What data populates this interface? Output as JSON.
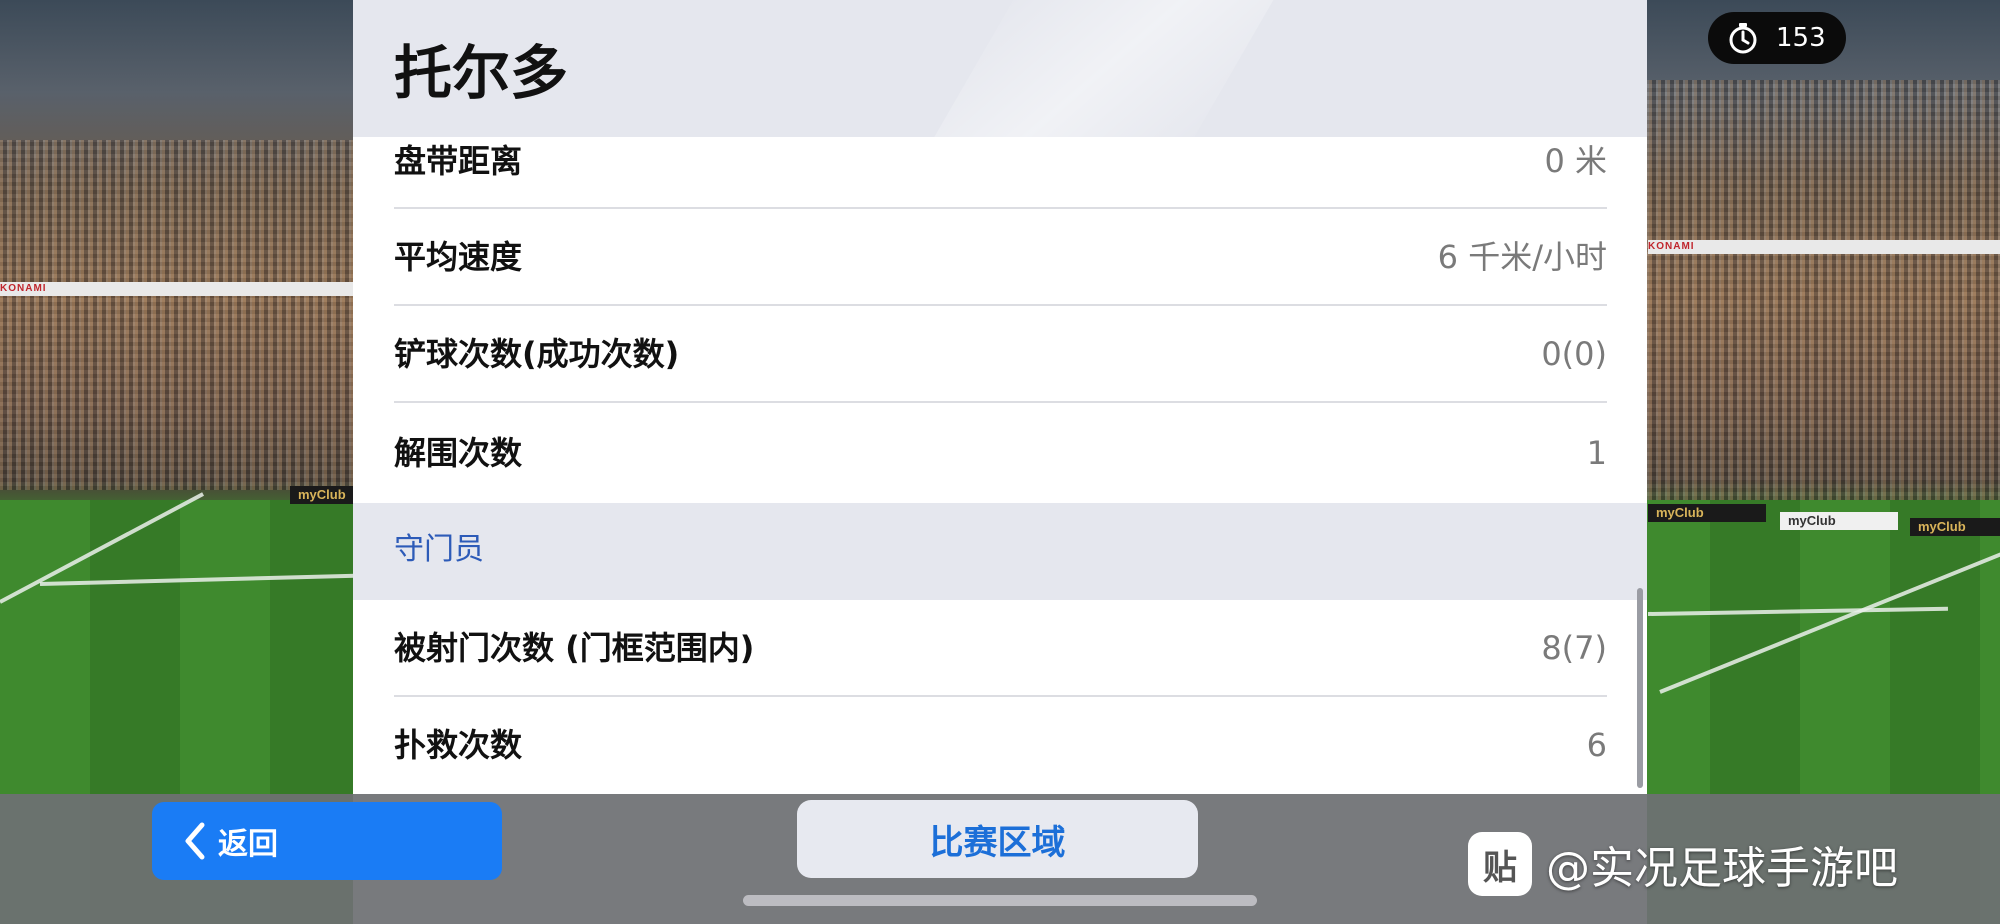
{
  "header": {
    "player_name": "托尔多"
  },
  "timer": {
    "icon": "stopwatch-icon",
    "value": "153"
  },
  "stats": {
    "rows": [
      {
        "label": "盘带距离",
        "value": "0 米"
      },
      {
        "label": "平均速度",
        "value": "6 千米/小时"
      },
      {
        "label": "铲球次数(成功次数)",
        "value": "0(0)"
      },
      {
        "label": "解围次数",
        "value": "1"
      }
    ],
    "goalkeeper_section": {
      "title": "守门员",
      "rows": [
        {
          "label": "被射门次数 (门框范围内)",
          "value": "8(7)"
        },
        {
          "label": "扑救次数",
          "value": "6"
        }
      ]
    }
  },
  "bottom_bar": {
    "back_label": "返回",
    "back_icon": "chevron-left-icon",
    "match_area_label": "比赛区域"
  },
  "background": {
    "ad_text": "myClub",
    "sponsor_text": "KONAMI"
  },
  "watermark": {
    "logo_text": "贴",
    "text": "@实况足球手游吧"
  },
  "colors": {
    "accent_blue": "#1a7cf5",
    "section_header_text": "#2d5bb8",
    "panel_header_bg": "#e5e7ee",
    "value_gray": "#7a7a7a"
  }
}
